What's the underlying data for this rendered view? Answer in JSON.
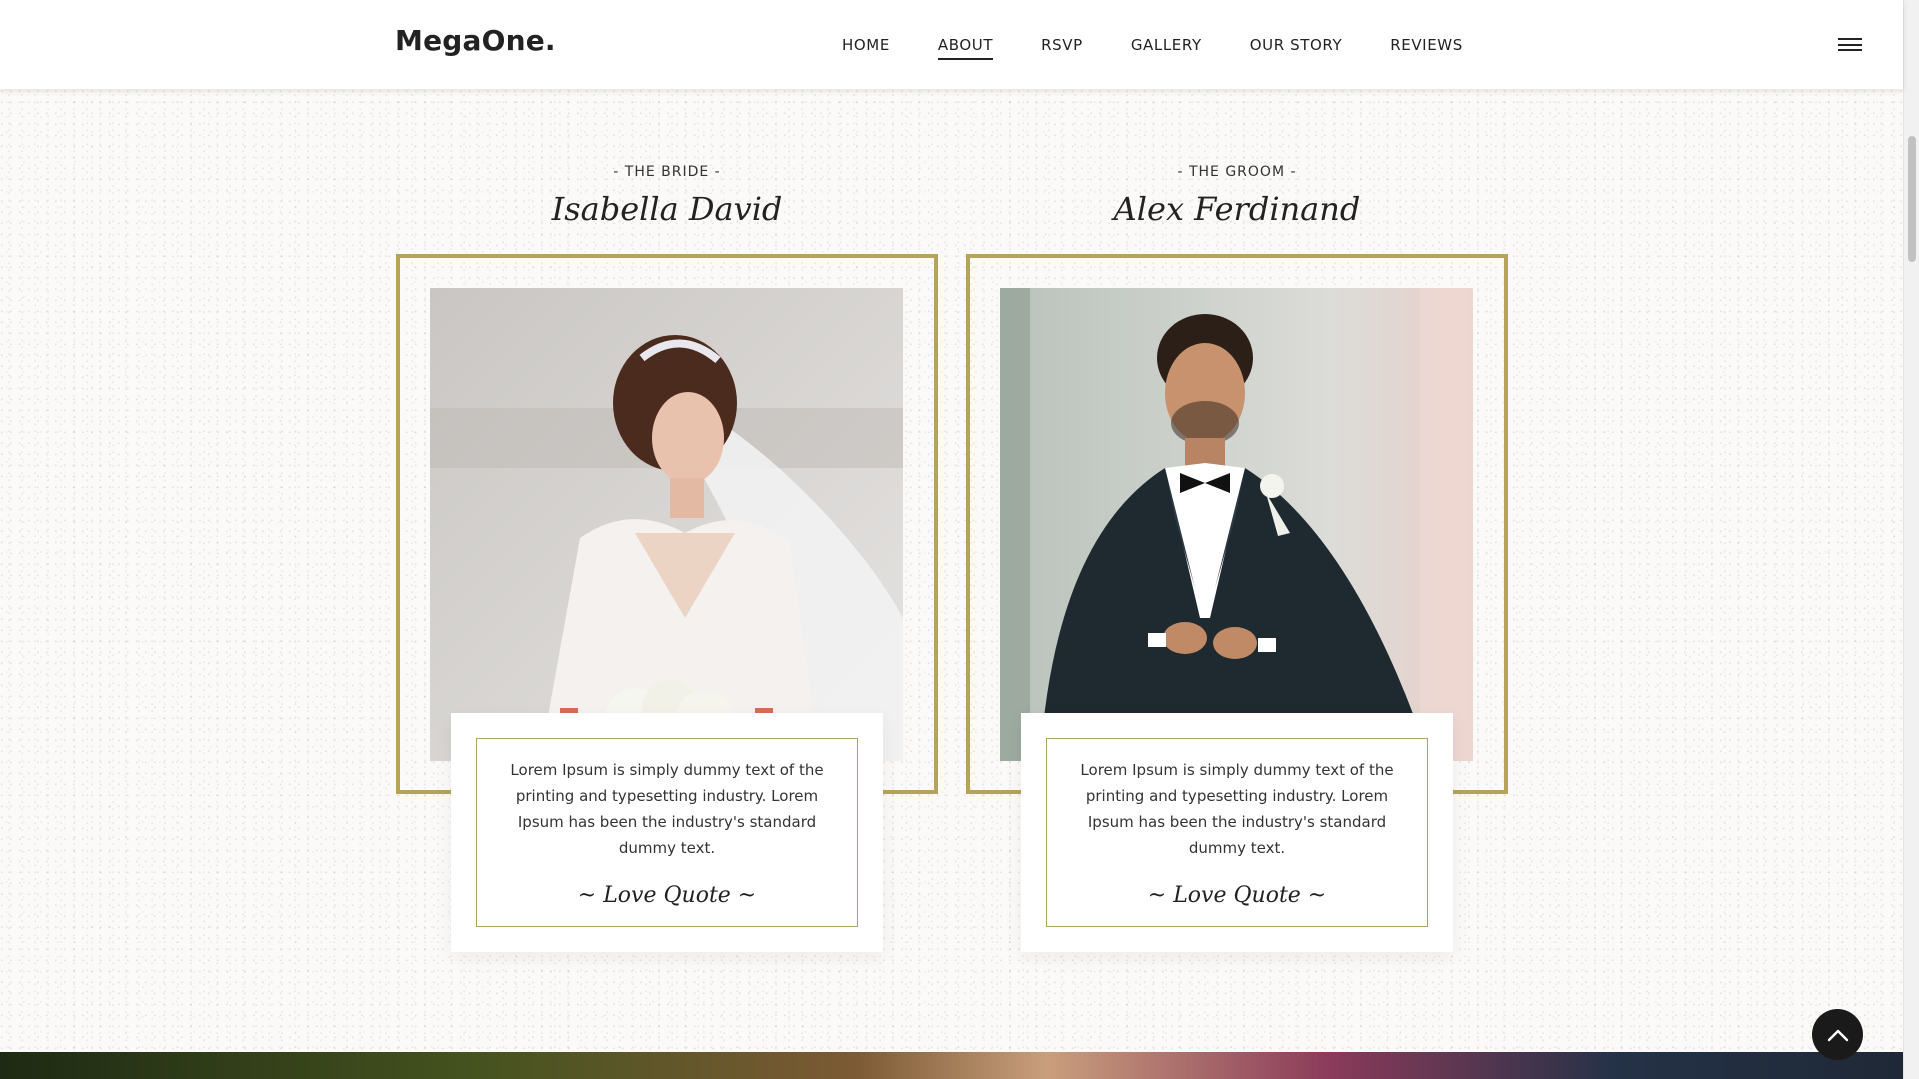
{
  "header": {
    "logo": "MegaOne.",
    "nav": [
      {
        "label": "HOME",
        "active": false
      },
      {
        "label": "ABOUT",
        "active": true
      },
      {
        "label": "RSVP",
        "active": false
      },
      {
        "label": "GALLERY",
        "active": false
      },
      {
        "label": "OUR STORY",
        "active": false
      },
      {
        "label": "REVIEWS",
        "active": false
      }
    ],
    "menu_icon": "hamburger-icon"
  },
  "bride": {
    "role": "- THE BRIDE -",
    "name": "Isabella David",
    "quote": "Lorem Ipsum is simply dummy text of the printing and typesetting industry. Lorem Ipsum has been the industry's standard dummy text.",
    "signature": "~ Love Quote ~"
  },
  "groom": {
    "role": "- THE GROOM -",
    "name": "Alex Ferdinand",
    "quote": "Lorem Ipsum is simply dummy text of the printing and typesetting industry. Lorem Ipsum has been the industry's standard dummy text.",
    "signature": "~ Love Quote ~"
  },
  "back_to_top_icon": "chevron-up-icon",
  "colors": {
    "gold": "#b5a35a",
    "dark": "#1a1a1a"
  }
}
